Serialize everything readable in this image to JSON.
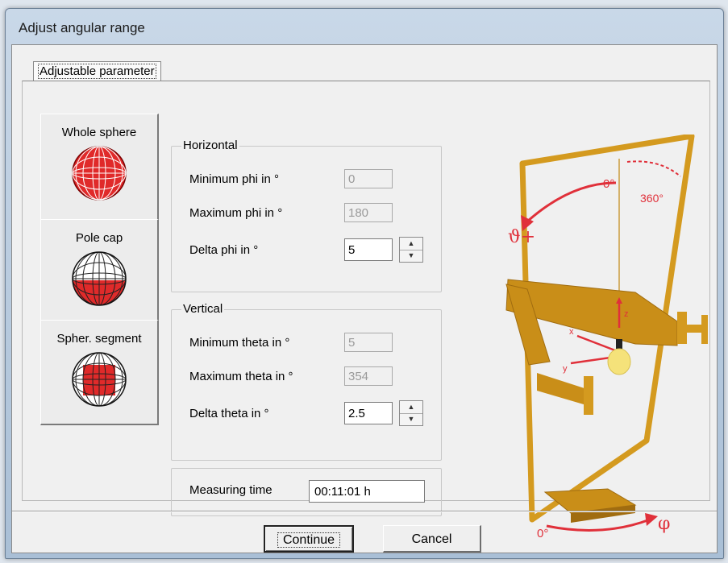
{
  "window": {
    "title": "Adjust angular range"
  },
  "tab": {
    "label": "Adjustable parameter"
  },
  "shapes": {
    "whole_sphere": "Whole sphere",
    "pole_cap": "Pole cap",
    "spher_segment": "Spher. segment",
    "selected": "Whole sphere"
  },
  "horizontal": {
    "title": "Horizontal",
    "min_label": "Minimum phi in °",
    "min_value": "0",
    "max_label": "Maximum phi in °",
    "max_value": "180",
    "delta_label": "Delta phi in °",
    "delta_value": "5"
  },
  "vertical": {
    "title": "Vertical",
    "min_label": "Minimum theta in °",
    "min_value": "5",
    "max_label": "Maximum theta in °",
    "max_value": "354",
    "delta_label": "Delta theta in °",
    "delta_value": "2.5"
  },
  "measuring": {
    "label": "Measuring time",
    "value": "00:11:01 h"
  },
  "diagram": {
    "zero_top": "0°",
    "three_sixty": "360°",
    "theta_symbol": "ϑ+",
    "z_axis": "z",
    "x_axis": "x",
    "y_axis": "y",
    "zero_bottom": "0°",
    "phi_symbol": "φ",
    "colors": {
      "frame": "#d49a1f",
      "accent": "#e0303a"
    }
  },
  "buttons": {
    "continue": "Continue",
    "cancel": "Cancel"
  }
}
